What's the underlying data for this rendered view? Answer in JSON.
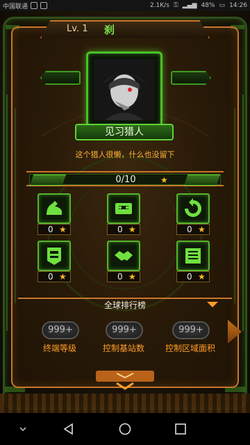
{
  "status_bar": {
    "carrier": "中国联通",
    "speed": "2.1K/s",
    "battery": "48%",
    "time": "14:26"
  },
  "player": {
    "level": "Lv. 1",
    "name": "刹",
    "title": "见习猎人",
    "signature": "这个猎人很懒，什么也没留下"
  },
  "progress": {
    "text": "0/10",
    "fraction": 0
  },
  "skills": [
    {
      "icon": "muscle-icon",
      "count": "0"
    },
    {
      "icon": "cassette-icon",
      "count": "0"
    },
    {
      "icon": "recycle-icon",
      "count": "0"
    },
    {
      "icon": "shield-banner-icon",
      "count": "0"
    },
    {
      "icon": "handshake-icon",
      "count": "0"
    },
    {
      "icon": "list-icon",
      "count": "0"
    }
  ],
  "ranking": {
    "title": "全球排行榜",
    "items": [
      {
        "value": "999+",
        "label": "终端等级"
      },
      {
        "value": "999+",
        "label": "控制基站数"
      },
      {
        "value": "999+",
        "label": "控制区域面积"
      }
    ]
  },
  "colors": {
    "accent_green": "#5fd238",
    "accent_orange": "#c9762c",
    "star": "#ffb72a",
    "signature": "#ffb338"
  }
}
